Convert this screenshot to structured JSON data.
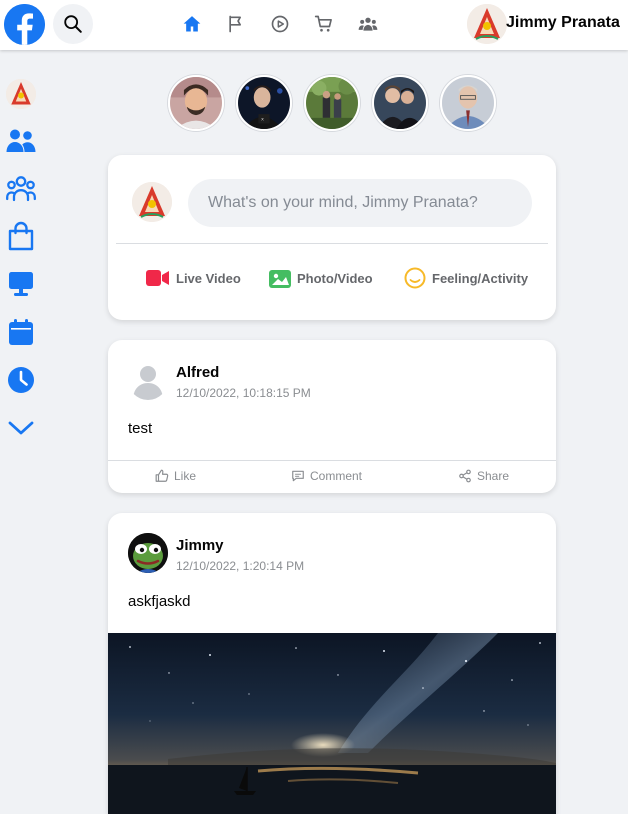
{
  "header": {
    "search_icon": "search-icon",
    "nav_icons": [
      "home-icon",
      "flag-icon",
      "play-icon",
      "cart-icon",
      "groups-icon"
    ],
    "profile_name": "Jimmy Pranata",
    "accent_color": "#1877f2"
  },
  "sidebar": {
    "items": [
      "profile-avatar",
      "friends-icon",
      "groups-icon",
      "marketplace-icon",
      "watch-icon",
      "events-icon",
      "memories-icon",
      "see-more-icon"
    ]
  },
  "composer": {
    "placeholder": "What's on your mind, Jimmy Pranata?",
    "actions": [
      {
        "label": "Live Video",
        "icon": "live-video-icon",
        "color": "#f02849"
      },
      {
        "label": "Photo/Video",
        "icon": "photo-video-icon",
        "color": "#45bd62"
      },
      {
        "label": "Feeling/Activity",
        "icon": "feeling-icon",
        "color": "#f7b928"
      }
    ]
  },
  "posts": [
    {
      "author": "Alfred",
      "time": "12/10/2022, 10:18:15 PM",
      "text": "test"
    },
    {
      "author": "Jimmy",
      "time": "12/10/2022, 1:20:14 PM",
      "text": "askfjaskd"
    }
  ],
  "post_actions": {
    "like": "Like",
    "comment": "Comment",
    "share": "Share"
  }
}
